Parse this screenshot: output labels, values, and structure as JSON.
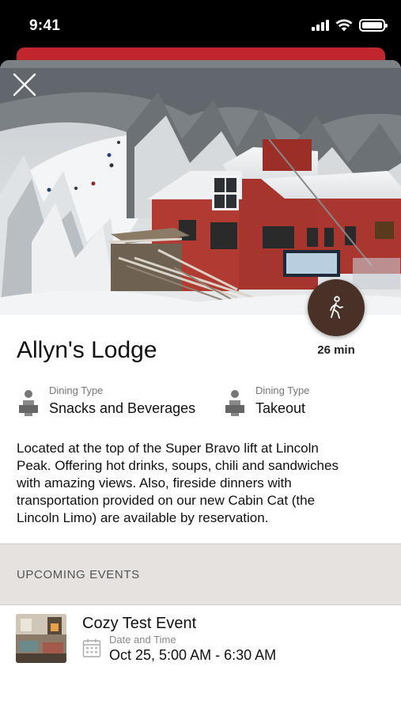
{
  "status_bar": {
    "time": "9:41"
  },
  "colors": {
    "brand_red": "#c0272d",
    "fab_brown": "#4a3128",
    "events_header_bg": "#e5e2e0"
  },
  "hero": {
    "close_icon": "close-icon",
    "photo": "snowy ski lodge photo"
  },
  "walk": {
    "icon": "walking-person-icon",
    "time": "26 min"
  },
  "venue": {
    "name": "Allyn's Lodge",
    "dining": [
      {
        "label": "Dining Type",
        "value": "Snacks and Beverages",
        "icon": "dining-person-icon"
      },
      {
        "label": "Dining Type",
        "value": "Takeout",
        "icon": "dining-person-icon"
      }
    ],
    "description_lines": [
      "Located at the top of the Super Bravo lift at Lincoln",
      "Peak. Offering hot drinks, soups, chili and sandwiches",
      "with amazing views. Also, fireside dinners with",
      "transportation provided on our new Cabin Cat (the",
      "Lincoln Limo) are available by reservation."
    ]
  },
  "events": {
    "header": "UPCOMING EVENTS",
    "items": [
      {
        "title": "Cozy Test Event",
        "date_label": "Date and Time",
        "date_value": "Oct 25, 5:00 AM - 6:30 AM",
        "icon": "calendar-icon"
      }
    ]
  }
}
